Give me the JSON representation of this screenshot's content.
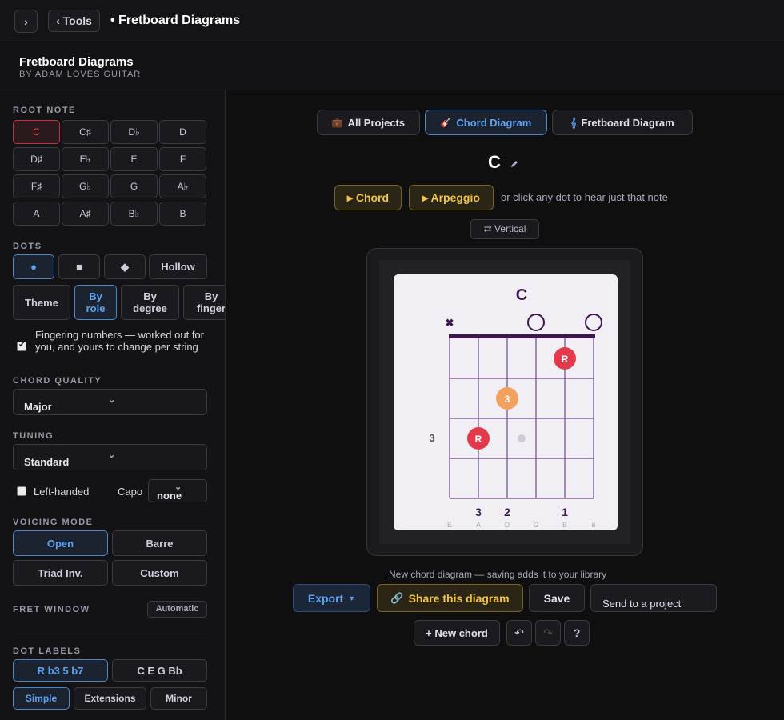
{
  "topbar": {
    "toggle_icon": "chevron-right-icon",
    "toggle_glyph": "›",
    "tools_label": "‹ Tools",
    "breadcrumb": "• Fretboard Diagrams"
  },
  "header": {
    "title": "Fretboard Diagrams",
    "subtitle": "BY ADAM LOVES GUITAR"
  },
  "sidebar": {
    "root_note_label": "ROOT NOTE",
    "root_notes": [
      "C",
      "C♯",
      "D♭",
      "D",
      "D♯",
      "E♭",
      "E",
      "F",
      "F♯",
      "G♭",
      "G",
      "A♭",
      "A",
      "A♯",
      "B♭",
      "B"
    ],
    "selected_root": "C",
    "dots_label": "DOTS",
    "dot_shapes": [
      "●",
      "■",
      "◆",
      "Hollow"
    ],
    "color_modes": [
      "Theme",
      "By role",
      "By degree",
      "By finger"
    ],
    "fingering_label": "Fingering numbers — worked out for you, and yours to change per string",
    "fingering_checked": true,
    "chord_quality_label": "CHORD QUALITY",
    "chord_quality_value": "Major",
    "tuning_label": "TUNING",
    "tuning_value": "Standard",
    "left_handed_label": "Left-handed",
    "capo_label": "Capo",
    "capo_value": "none",
    "voicing_label": "VOICING MODE",
    "voicings": [
      "Open",
      "Barre",
      "Triad Inv.",
      "Custom"
    ],
    "fret_window_label": "FRET WINDOW",
    "fret_window_value": "Automatic",
    "dot_labels_label": "DOT LABELS",
    "label_modes": [
      "R b3 5 b7",
      "C E G Bb"
    ],
    "label_sets": [
      "Simple",
      "Extensions",
      "Minor"
    ]
  },
  "main": {
    "tabs": [
      {
        "label": "All Projects",
        "icon": "briefcase-icon",
        "glyph": "💼"
      },
      {
        "label": "Chord Diagram",
        "icon": "guitar-icon",
        "glyph": "🎸"
      },
      {
        "label": "Fretboard Diagram",
        "icon": "music-note-icon",
        "glyph": "𝄞"
      }
    ],
    "chord_name": "C",
    "edit_icon": "pencil-icon",
    "play_chord": "▸ Chord",
    "play_arpeggio": "▸ Arpeggio",
    "hint": "or click any dot to hear just that note",
    "orientation": "⇄ Vertical",
    "diagram": {
      "title": "C",
      "fret_label": "3",
      "string_names": [
        "E",
        "A",
        "D",
        "G",
        "B",
        "e"
      ],
      "fingers": [
        "3",
        "2",
        "",
        "1"
      ],
      "muted_glyph": "✖",
      "dot_labels": [
        "R",
        "3",
        "R"
      ]
    },
    "status": "New chord diagram — saving adds it to your library",
    "export_label": "Export",
    "share_label": "Share this diagram",
    "save_label": "Save",
    "send_label": "Send to a project",
    "new_chord_label": "+ New chord",
    "undo_glyph": "↶",
    "redo_glyph": "↷",
    "help_glyph": "?"
  },
  "colors": {
    "accent_blue": "#5ea2ef",
    "root_red": "#e33a4b",
    "third_orange": "#f2a15e",
    "gold": "#f0c34a",
    "diagram_purple": "#3d1850"
  }
}
